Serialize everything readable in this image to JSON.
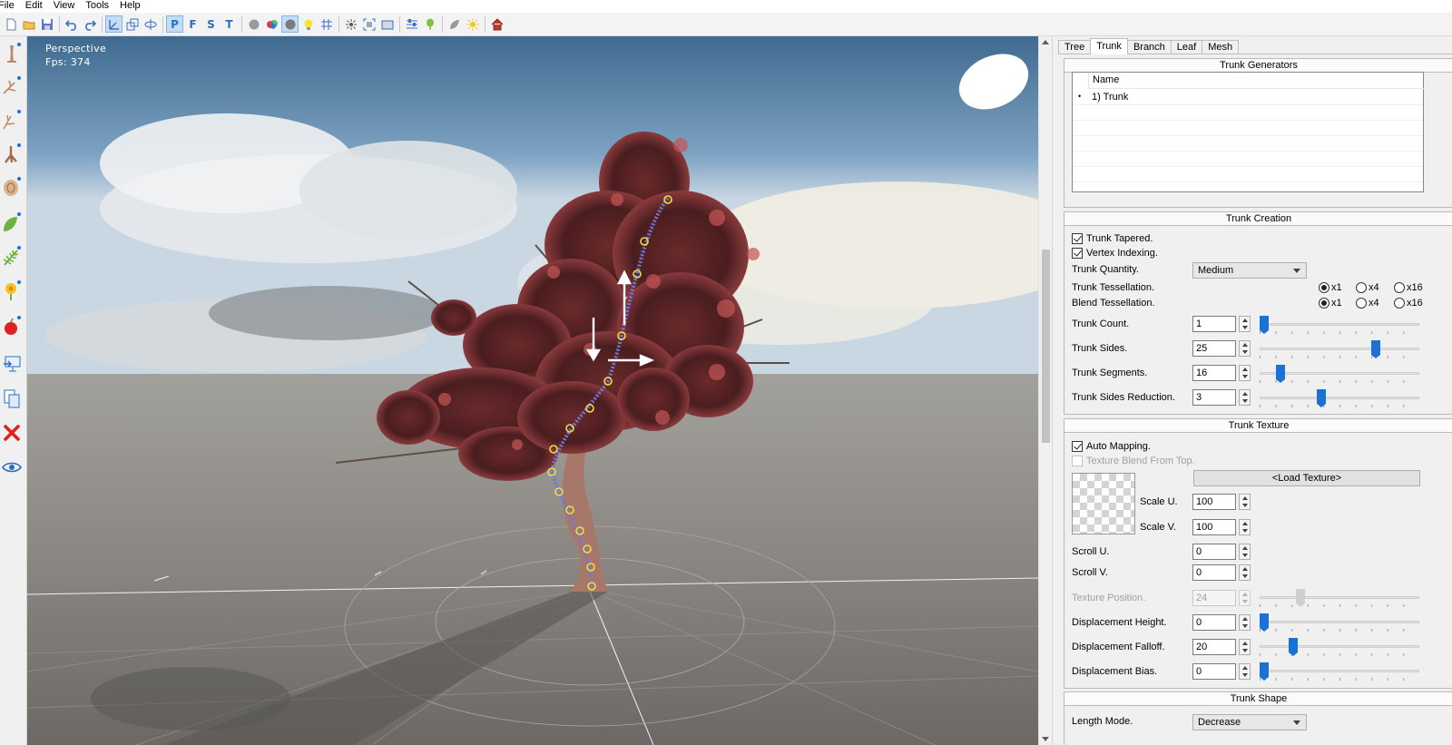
{
  "menu": [
    "File",
    "Edit",
    "View",
    "Tools",
    "Help"
  ],
  "toolbar": {
    "view_letters": [
      "P",
      "F",
      "S",
      "T"
    ],
    "icons": [
      "new-file-icon",
      "open-folder-icon",
      "save-icon",
      "undo-icon",
      "redo-icon",
      "move-gizmo-icon",
      "scale-gizmo-icon",
      "rotate-gizmo-icon",
      "perspective-view",
      "front-view",
      "side-view",
      "top-view",
      "sphere-shading-icon",
      "color-material-icon",
      "textured-sphere-icon",
      "light-bulb-icon",
      "grid-icon",
      "wind-icon",
      "zoom-extents-icon",
      "screenshot-icon",
      "settings-sliders-icon",
      "balloon-icon",
      "leaf-icon",
      "sun-icon",
      "house-icon"
    ]
  },
  "left_tools": [
    "add-trunk-icon",
    "add-branch-icon",
    "add-twig-icon",
    "add-roots-icon",
    "add-cap-icon",
    "add-leaf-icon",
    "add-frond-icon",
    "add-flower-icon",
    "add-fruit-icon",
    "export-icon",
    "copy-icon",
    "delete-icon",
    "visibility-icon"
  ],
  "viewport": {
    "mode": "Perspective",
    "fps": "Fps: 374"
  },
  "tabs": [
    {
      "label": "Tree",
      "active": false
    },
    {
      "label": "Trunk",
      "active": true
    },
    {
      "label": "Branch",
      "active": false
    },
    {
      "label": "Leaf",
      "active": false
    },
    {
      "label": "Mesh",
      "active": false
    }
  ],
  "trunk_generators": {
    "title": "Trunk Generators",
    "column": "Name",
    "rows": [
      {
        "bullet": "•",
        "name": "1) Trunk"
      }
    ]
  },
  "trunk_creation": {
    "title": "Trunk Creation",
    "tapered": {
      "label": "Trunk Tapered.",
      "checked": true
    },
    "vertex_indexing": {
      "label": "Vertex Indexing.",
      "checked": true
    },
    "quantity": {
      "label": "Trunk Quantity.",
      "value": "Medium"
    },
    "tessellation": {
      "label": "Trunk Tessellation.",
      "options": [
        "x1",
        "x4",
        "x16"
      ],
      "selected": "x1"
    },
    "blend_tessellation": {
      "label": "Blend Tessellation.",
      "options": [
        "x1",
        "x4",
        "x16"
      ],
      "selected": "x1"
    },
    "count": {
      "label": "Trunk Count.",
      "value": "1",
      "slider": 0.0
    },
    "sides": {
      "label": "Trunk Sides.",
      "value": "25",
      "slider": 0.74
    },
    "segments": {
      "label": "Trunk Segments.",
      "value": "16",
      "slider": 0.11
    },
    "sides_reduction": {
      "label": "Trunk Sides Reduction.",
      "value": "3",
      "slider": 0.38
    }
  },
  "trunk_texture": {
    "title": "Trunk Texture",
    "auto_mapping": {
      "label": "Auto Mapping.",
      "checked": true
    },
    "blend_from_top": {
      "label": "Texture Blend From Top.",
      "checked": false,
      "disabled": true
    },
    "load_button": "<Load Texture>",
    "scale_u": {
      "label": "Scale U.",
      "value": "100"
    },
    "scale_v": {
      "label": "Scale V.",
      "value": "100"
    },
    "scroll_u": {
      "label": "Scroll U.",
      "value": "0"
    },
    "scroll_v": {
      "label": "Scroll V.",
      "value": "0"
    },
    "position": {
      "label": "Texture Position.",
      "value": "24",
      "slider": 0.24,
      "disabled": true
    },
    "disp_height": {
      "label": "Displacement Height.",
      "value": "0",
      "slider": 0.0
    },
    "disp_falloff": {
      "label": "Displacement Falloff.",
      "value": "20",
      "slider": 0.19
    },
    "disp_bias": {
      "label": "Displacement Bias.",
      "value": "0",
      "slider": 0.0
    }
  },
  "trunk_shape": {
    "title": "Trunk Shape",
    "length_mode": {
      "label": "Length Mode.",
      "value": "Decrease"
    }
  },
  "colors": {
    "accent": "#1a73d4",
    "spine": "#6f78d8",
    "node": "#e8e04a"
  }
}
